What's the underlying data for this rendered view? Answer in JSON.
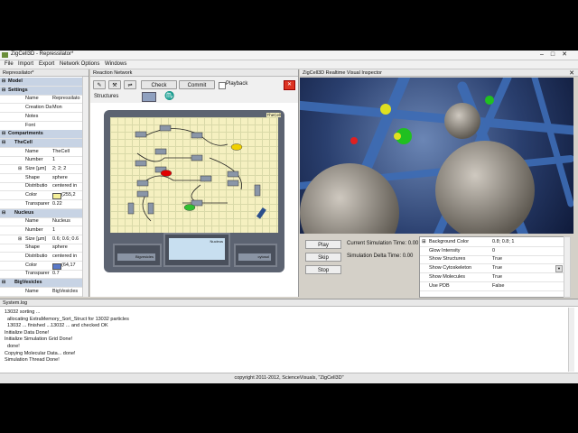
{
  "window": {
    "title": "ZigCell3D - Repressilator*"
  },
  "menu": [
    "File",
    "Import",
    "Export",
    "Network Options",
    "Windows"
  ],
  "left_panel": {
    "header": "Repressilator*",
    "rows": [
      {
        "type": "sec",
        "toggle": "⊟",
        "key": "Model",
        "val": ""
      },
      {
        "type": "sec",
        "toggle": "⊟",
        "key": "Settings",
        "val": ""
      },
      {
        "type": "row",
        "key": "Name",
        "val": "Repressilato"
      },
      {
        "type": "row",
        "key": "Creation Date",
        "val": "Mon"
      },
      {
        "type": "row",
        "key": "Notes",
        "val": ""
      },
      {
        "type": "row",
        "key": "Font",
        "val": ""
      },
      {
        "type": "sec",
        "toggle": "⊟",
        "key": "Compartments",
        "val": ""
      },
      {
        "type": "sec",
        "toggle": "⊟",
        "key": "TheCell",
        "val": ""
      },
      {
        "type": "row",
        "key": "Name",
        "val": "TheCell"
      },
      {
        "type": "row",
        "key": "Number",
        "val": "1"
      },
      {
        "type": "row",
        "toggle": "⊞",
        "key": "Size [µm]",
        "val": "2; 2; 2"
      },
      {
        "type": "row",
        "key": "Shape",
        "val": "sphere"
      },
      {
        "type": "row",
        "key": "Distributio",
        "val": "centered in"
      },
      {
        "type": "row",
        "key": "Color",
        "val": "(255,2"
      },
      {
        "type": "row",
        "key": "Transparer",
        "val": "0.22"
      },
      {
        "type": "sec",
        "toggle": "⊟",
        "key": "Nucleus",
        "val": ""
      },
      {
        "type": "row",
        "key": "Name",
        "val": "Nucleus"
      },
      {
        "type": "row",
        "key": "Number",
        "val": "1"
      },
      {
        "type": "row",
        "toggle": "⊞",
        "key": "Size [µm]",
        "val": "0.6; 0.6; 0.6"
      },
      {
        "type": "row",
        "key": "Shape",
        "val": "sphere"
      },
      {
        "type": "row",
        "key": "Distributio",
        "val": "centered in"
      },
      {
        "type": "row",
        "key": "Color",
        "val": "(64,17"
      },
      {
        "type": "row",
        "key": "Transparer",
        "val": "0.7"
      },
      {
        "type": "sec",
        "toggle": "⊟",
        "key": "BigVesicles",
        "val": ""
      },
      {
        "type": "row",
        "key": "Name",
        "val": "BigVesicles"
      }
    ]
  },
  "center_panel": {
    "header": "Reaction Network",
    "check_label": "Check",
    "commit_label": "Commit",
    "playback_label": "Playback",
    "structures_label": "Structures",
    "cell_label": "TheCell",
    "nucleus_label": "Nucleus",
    "box1_label": "Bigvesicles",
    "box2_label": "cytosol"
  },
  "right_panel": {
    "header": "ZigCell3D Realtime Visual Inspector",
    "play_label": "Play",
    "skip_label": "Skip",
    "stop_label": "Stop",
    "sim_time": "Current Simulation Time: 0.00",
    "delta_time": "Simulation Delta Time: 0.00",
    "inspector": [
      {
        "key": "Background Color",
        "val": "0.8; 0.8; 1",
        "toggle": "⊞"
      },
      {
        "key": "Glow Intensity",
        "val": "0"
      },
      {
        "key": "Show Structures",
        "val": "True"
      },
      {
        "key": "Show Cytoskeleton",
        "val": "True"
      },
      {
        "key": "Show Molecules",
        "val": "True"
      },
      {
        "key": "Use PDB",
        "val": "False"
      }
    ]
  },
  "log": {
    "header": "System.log",
    "lines": [
      "13032 sorting ...",
      "  allocating ExtraMemory_Sort_Struct for 13032 particles",
      "  13032 ... finished ...13032 ... and checked OK",
      "Initialize Data Done!",
      "Initialize Simulation Grid Done!",
      "  done!",
      "Copying Molecular Data... done!",
      "Simulation Thread Done!"
    ]
  },
  "status": "copyright 2011-2012, ScienceVisuals, \"ZigCell3D\"",
  "colors": {
    "section_bg": "#c7d3e4",
    "cell_yellow": "#f5f0c0",
    "viewport_blue": "#2a3f6e"
  }
}
